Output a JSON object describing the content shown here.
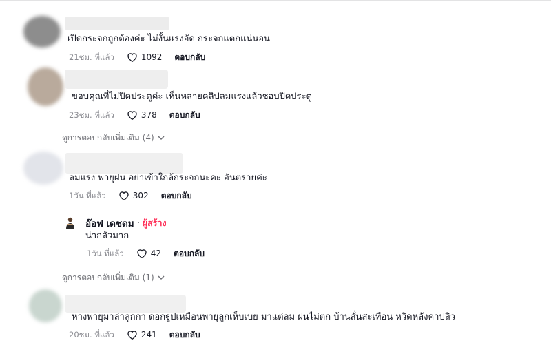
{
  "comments": [
    {
      "text": "เปิดกระจกถูกต้องค่ะ ไม่งั้นแรงอัด กระจกแตกแน่นอน",
      "time": "21ชม. ที่แล้ว",
      "likes": "1092",
      "reply": "ตอบกลับ"
    },
    {
      "text": "ขอบคุณที่ไม่ปิดประตูค่ะ เห็นหลายคลิปลมแรงแล้วชอบปิดประตู",
      "time": "23ชม. ที่แล้ว",
      "likes": "378",
      "reply": "ตอบกลับ",
      "more": "ดูการตอบกลับเพิ่มเติม (4)"
    },
    {
      "text": "ลมแรง พายุฝน อย่าเข้าใกล้กระจกนะคะ อันตรายค่ะ",
      "time": "1วัน ที่แล้ว",
      "likes": "302",
      "reply": "ตอบกลับ"
    },
    {
      "text": "หางพายุมาล่าลูกกา ดอกฐูปเหมือนพายุลูกเห็บเบย มาแต่ลม ฝนไม่ตก บ้านสั่นสะเทือน หวิดหลังคาปลิว",
      "time": "20ชม. ที่แล้ว",
      "likes": "241",
      "reply": "ตอบกลับ"
    }
  ],
  "creator_reply": {
    "name": "อ๊อฟ เดชดม",
    "dot": "·",
    "badge": "ผู้สร้าง",
    "text": "น่ากลัวมาก",
    "time": "1วัน ที่แล้ว",
    "likes": "42",
    "reply": "ตอบกลับ",
    "more": "ดูการตอบกลับเพิ่มเติม (1)"
  },
  "colors": {
    "creator_badge": "#fe2c55",
    "meta": "#8a8b91",
    "text": "#161823"
  },
  "icons": {
    "like": "heart-outline-icon",
    "expand": "chevron-down-icon"
  }
}
